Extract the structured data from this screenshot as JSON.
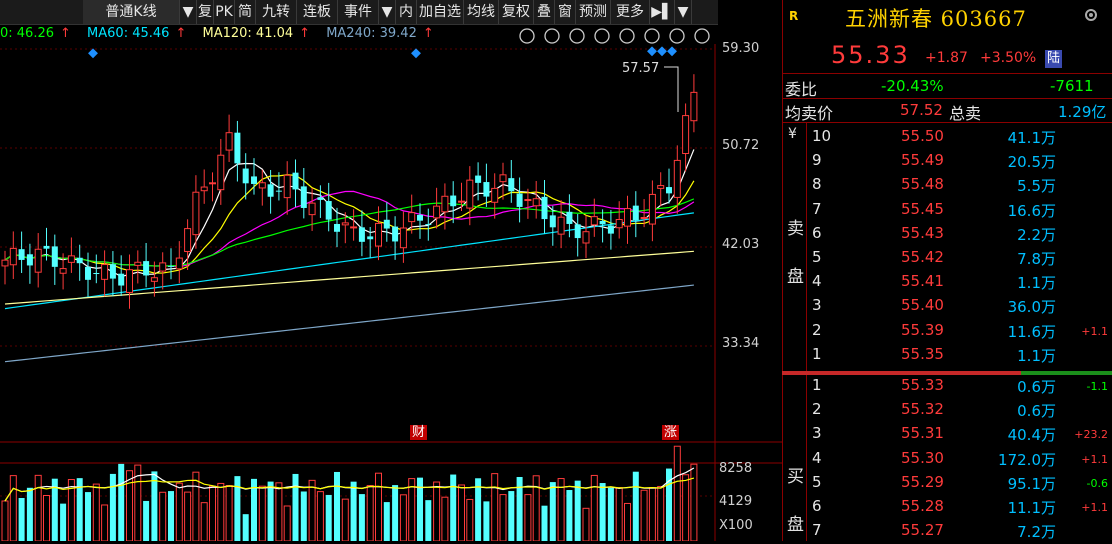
{
  "toolbar": {
    "items": [
      "普通K线",
      "▼",
      "复",
      "PK",
      "简",
      "九转",
      "连板",
      "事件",
      "▼",
      "内",
      "加自选",
      "均线",
      "复权",
      "叠",
      "窗",
      "预测",
      "更多",
      "▶▌",
      "▼"
    ]
  },
  "ma_legend": {
    "ma_partial": "0: 46.26",
    "ma60_label": "MA60: 45.46",
    "ma120_label": "MA120: 41.04",
    "ma240_label": "MA240: 39.42",
    "arrow": "↑"
  },
  "chart_icons": [
    "eye-icon",
    "back-circle-icon",
    "play-circle-icon",
    "undo-icon",
    "scissors-icon",
    "lock-icon",
    "zoom-in-icon",
    "zoom-out-icon"
  ],
  "y_axis": {
    "labels": [
      "59.30",
      "50.72",
      "42.03",
      "33.34"
    ]
  },
  "max_marker": "57.57",
  "event_markers": {
    "cai": "财",
    "zhang": "涨"
  },
  "volume_axis": {
    "labels": [
      "8258",
      "4129",
      "X100"
    ]
  },
  "quote": {
    "r_badge": "R",
    "title": "五洲新春 603667",
    "price": "55.33",
    "change": "+1.87",
    "pct": "+3.50%",
    "exchange_badge": "陆"
  },
  "stats": {
    "weibi_label": "委比",
    "weibi_value": "-20.43%",
    "weicha_value": "-7611",
    "avg_sell_label": "均卖价",
    "avg_sell_value": "57.52",
    "total_sell_label": "总卖",
    "total_sell_value": "1.29亿"
  },
  "orderbook": {
    "currency": "¥",
    "sell_label_1": "卖",
    "sell_label_2": "盘",
    "buy_label_1": "买",
    "buy_label_2": "盘",
    "sells": [
      {
        "level": "10",
        "price": "55.50",
        "vol": "41.1万",
        "chg": ""
      },
      {
        "level": "9",
        "price": "55.49",
        "vol": "20.5万",
        "chg": ""
      },
      {
        "level": "8",
        "price": "55.48",
        "vol": "5.5万",
        "chg": ""
      },
      {
        "level": "7",
        "price": "55.45",
        "vol": "16.6万",
        "chg": ""
      },
      {
        "level": "6",
        "price": "55.43",
        "vol": "2.2万",
        "chg": ""
      },
      {
        "level": "5",
        "price": "55.42",
        "vol": "7.8万",
        "chg": ""
      },
      {
        "level": "4",
        "price": "55.41",
        "vol": "1.1万",
        "chg": ""
      },
      {
        "level": "3",
        "price": "55.40",
        "vol": "36.0万",
        "chg": ""
      },
      {
        "level": "2",
        "price": "55.39",
        "vol": "11.6万",
        "chg": "+1.1"
      },
      {
        "level": "1",
        "price": "55.35",
        "vol": "1.1万",
        "chg": ""
      }
    ],
    "buys": [
      {
        "level": "1",
        "price": "55.33",
        "vol": "0.6万",
        "chg": "-1.1"
      },
      {
        "level": "2",
        "price": "55.32",
        "vol": "0.6万",
        "chg": ""
      },
      {
        "level": "3",
        "price": "55.31",
        "vol": "40.4万",
        "chg": "+23.2"
      },
      {
        "level": "4",
        "price": "55.30",
        "vol": "172.0万",
        "chg": "+1.1"
      },
      {
        "level": "5",
        "price": "55.29",
        "vol": "95.1万",
        "chg": "-0.6"
      },
      {
        "level": "6",
        "price": "55.28",
        "vol": "11.1万",
        "chg": "+1.1"
      },
      {
        "level": "7",
        "price": "55.27",
        "vol": "7.2万",
        "chg": ""
      }
    ]
  },
  "colors": {
    "up": "#ff3b3b",
    "down": "#54ffff",
    "ma5": "#ffffff",
    "ma10": "#ffff00",
    "ma20": "#ff00ff",
    "ma30": "#00ff00",
    "ma60": "#00e5ff",
    "ma120": "#ffff99",
    "ma240": "#7fa7c9",
    "price_red": "#ff3b3b",
    "value_green": "#00ff00",
    "value_cyan": "#00bfff"
  }
}
